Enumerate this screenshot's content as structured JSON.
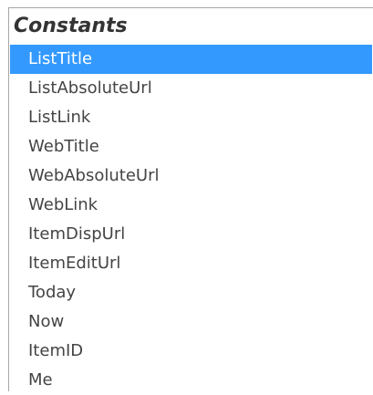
{
  "panel": {
    "title": "Constants",
    "selected_index": 0,
    "items": [
      {
        "label": "ListTitle"
      },
      {
        "label": "ListAbsoluteUrl"
      },
      {
        "label": "ListLink"
      },
      {
        "label": "WebTitle"
      },
      {
        "label": "WebAbsoluteUrl"
      },
      {
        "label": "WebLink"
      },
      {
        "label": "ItemDispUrl"
      },
      {
        "label": "ItemEditUrl"
      },
      {
        "label": "Today"
      },
      {
        "label": "Now"
      },
      {
        "label": "ItemID"
      },
      {
        "label": "Me"
      }
    ]
  },
  "colors": {
    "selection": "#3399ff",
    "selection_text": "#ffffff",
    "item_text": "#444444",
    "header_text": "#333333"
  }
}
